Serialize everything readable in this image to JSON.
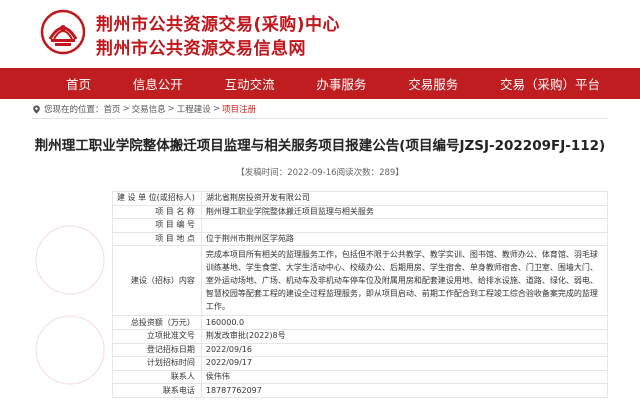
{
  "header": {
    "title_line1": "荆州市公共资源交易(采购)中心",
    "title_line2": "荆州市公共资源交易信息网"
  },
  "nav": [
    {
      "label": "首页"
    },
    {
      "label": "信息公开"
    },
    {
      "label": "互动交流"
    },
    {
      "label": "办事服务"
    },
    {
      "label": "交易服务"
    },
    {
      "label": "交易（采购）平台"
    }
  ],
  "breadcrumb": {
    "prefix": "您现在的位置：",
    "home": "首页",
    "section": "交易信息",
    "category": "工程建设",
    "current": "项目注册",
    "separator": ">"
  },
  "article": {
    "title": "荆州理工职业学院整体搬迁项目监理与相关服务项目报建公告(项目编号JZSJ-202209FJ-112)",
    "meta": "【发稿时间：2022-09-16阅读次数：289】"
  },
  "info_rows": [
    {
      "label": "建 设 单 位(或招标人)",
      "value": "湖北省荆房投资开发有限公司"
    },
    {
      "label": "项 目 名 称",
      "value": "荆州理工职业学院整体搬迁项目监理与相关服务"
    },
    {
      "label": "项 目 编 号",
      "value": ""
    },
    {
      "label": "项 目 地 点",
      "value": "位于荆州市荆州区学苑路"
    },
    {
      "label": "建设（招标）内容",
      "value": "完成本项目所有相关的监理服务工作，包括但不限于公共教学、教学实训、图书馆、教师办公、体育馆、羽毛球训练基地、学生食堂、大学生活动中心、校级办公、后期用房、学生宿舍、单身教师宿舍、门卫室、围墙大门、室外运动场地、广场、机动车及非机动车停车位及附属用房和配套建设用地、给排水设施、道路、绿化、弱电、智慧校园等配套工程的建设全过程监理服务，即从项目启动、前期工作配合到工程竣工综合验收备案完成的监理工作。"
    },
    {
      "label": "总投资额（万元）",
      "value": "160000.0"
    },
    {
      "label": "立项批准文号",
      "value": "荆发改审批(2022)8号"
    },
    {
      "label": "登记招标日期",
      "value": "2022/09/16"
    },
    {
      "label": "计划招标时间",
      "value": "2022/09/17"
    },
    {
      "label": "联系人",
      "value": "侯伟伟"
    },
    {
      "label": "联系电话",
      "value": "18787762097"
    }
  ],
  "colors": {
    "brand_red": "#c0161c",
    "nav_bg": "#bf1d20",
    "link_active": "#d11d20"
  },
  "icons": {
    "logo": "emblem-logo",
    "location": "location-pin-icon"
  }
}
